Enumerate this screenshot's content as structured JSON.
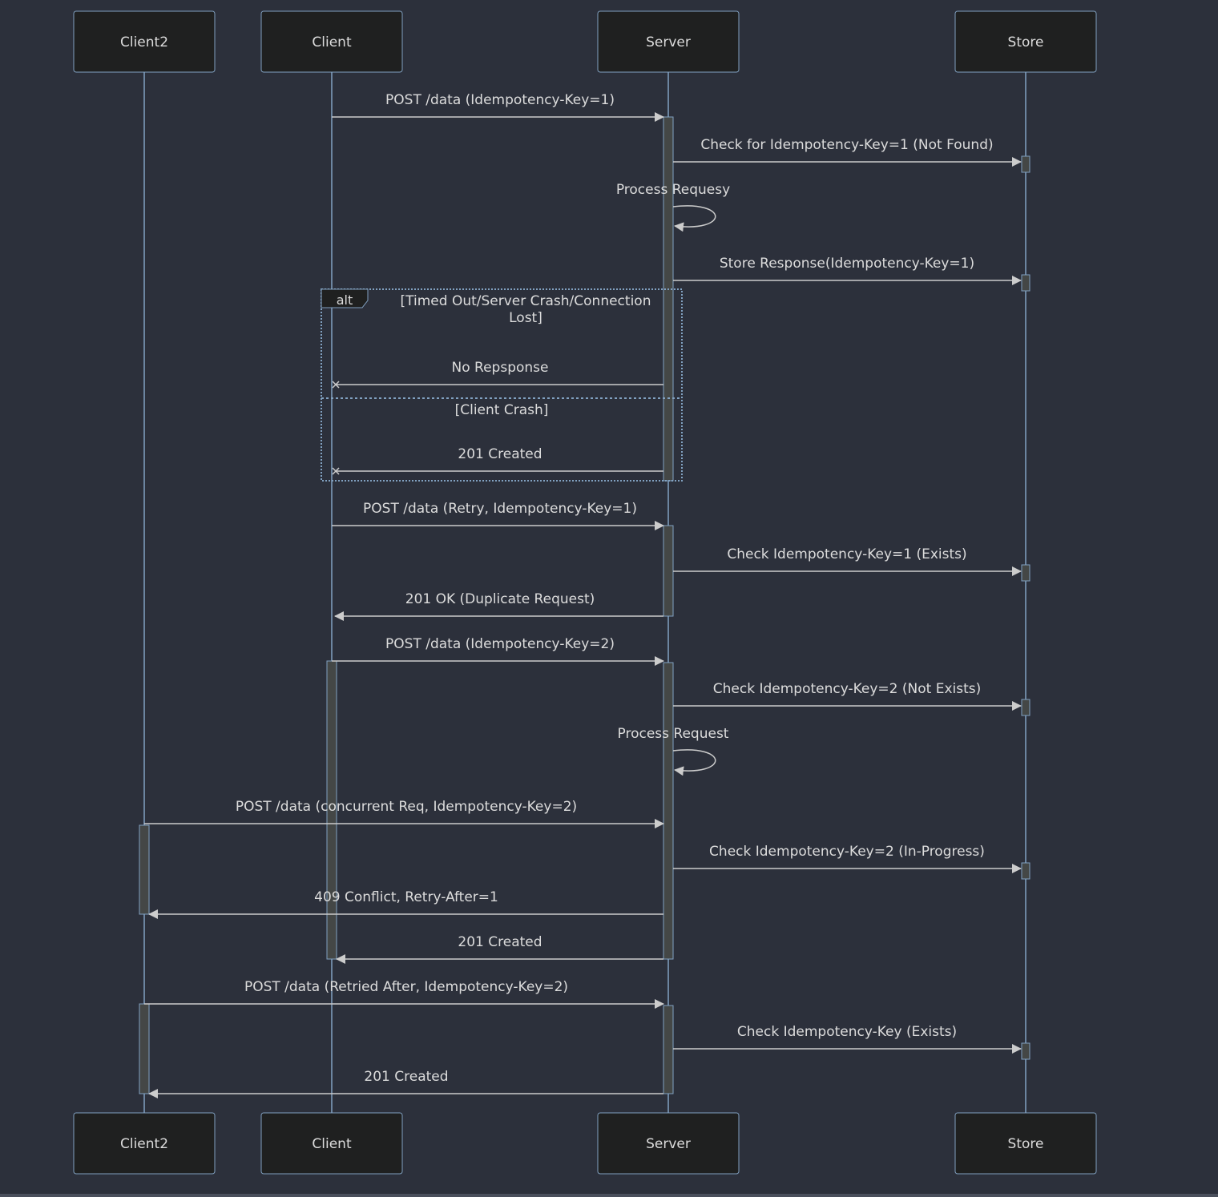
{
  "diagram": {
    "type": "sequence",
    "colors": {
      "background": "#2c303b",
      "actor_fill": "#1f2020",
      "actor_border": "#81a1c1",
      "lifeline": "#81a1c1",
      "message_line": "#cccccc",
      "text": "#dcdcdc",
      "activation_fill": "#444746",
      "frame_border": "#81a1c1"
    },
    "actors": [
      {
        "id": "client2",
        "label": "Client2"
      },
      {
        "id": "client",
        "label": "Client"
      },
      {
        "id": "server",
        "label": "Server"
      },
      {
        "id": "store",
        "label": "Store"
      }
    ],
    "messages": [
      {
        "from": "client",
        "to": "server",
        "label": "POST /data (Idempotency-Key=1)",
        "kind": "arrow"
      },
      {
        "from": "server",
        "to": "store",
        "label": "Check for Idempotency-Key=1 (Not Found)",
        "kind": "arrow"
      },
      {
        "from": "server",
        "to": "server",
        "label": "Process Requesy",
        "kind": "self"
      },
      {
        "from": "server",
        "to": "store",
        "label": "Store Response(Idempotency-Key=1)",
        "kind": "arrow"
      },
      {
        "from": "server",
        "to": "client",
        "label": "No Repsponse",
        "kind": "cross"
      },
      {
        "from": "server",
        "to": "client",
        "label": "201 Created",
        "kind": "cross"
      },
      {
        "from": "client",
        "to": "server",
        "label": "POST /data (Retry, Idempotency-Key=1)",
        "kind": "arrow"
      },
      {
        "from": "server",
        "to": "store",
        "label": "Check Idempotency-Key=1 (Exists)",
        "kind": "arrow"
      },
      {
        "from": "server",
        "to": "client",
        "label": "201 OK (Duplicate Request)",
        "kind": "arrow"
      },
      {
        "from": "client",
        "to": "server",
        "label": "POST /data (Idempotency-Key=2)",
        "kind": "arrow"
      },
      {
        "from": "server",
        "to": "store",
        "label": "Check Idempotency-Key=2 (Not Exists)",
        "kind": "arrow"
      },
      {
        "from": "server",
        "to": "server",
        "label": "Process Request",
        "kind": "self"
      },
      {
        "from": "client2",
        "to": "server",
        "label": "POST /data (concurrent Req, Idempotency-Key=2)",
        "kind": "arrow"
      },
      {
        "from": "server",
        "to": "store",
        "label": "Check Idempotency-Key=2 (In-Progress)",
        "kind": "arrow"
      },
      {
        "from": "server",
        "to": "client2",
        "label": "409 Conflict, Retry-After=1",
        "kind": "arrow"
      },
      {
        "from": "server",
        "to": "client",
        "label": "201 Created",
        "kind": "arrow"
      },
      {
        "from": "client2",
        "to": "server",
        "label": "POST /data (Retried After, Idempotency-Key=2)",
        "kind": "arrow"
      },
      {
        "from": "server",
        "to": "store",
        "label": "Check Idempotency-Key (Exists)",
        "kind": "arrow"
      },
      {
        "from": "server",
        "to": "client2",
        "label": "201 Created",
        "kind": "arrow"
      }
    ],
    "alt_frame": {
      "keyword": "alt",
      "sections": [
        {
          "condition": [
            "[Timed Out/Server Crash/Connection",
            "Lost]"
          ],
          "messages": [
            4
          ]
        },
        {
          "condition": [
            "[Client Crash]"
          ],
          "messages": [
            5
          ]
        }
      ]
    }
  }
}
